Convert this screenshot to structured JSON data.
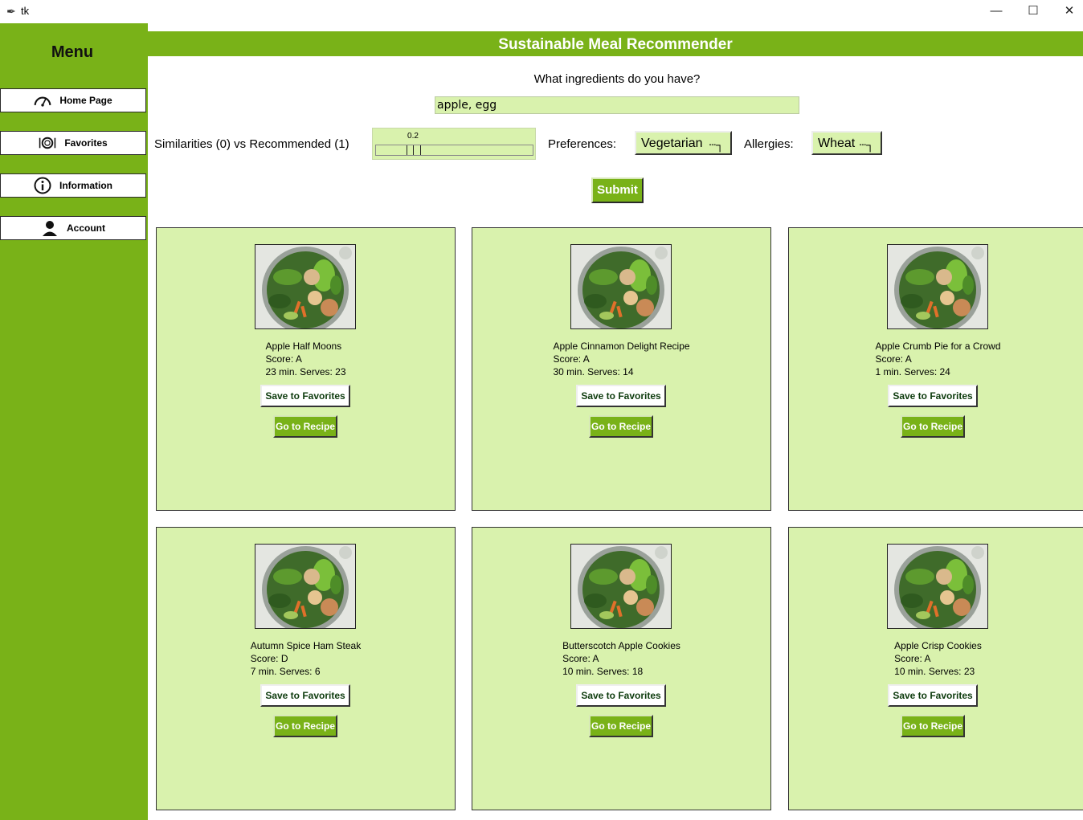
{
  "window": {
    "title": "tk",
    "icon": "feather-icon",
    "controls": [
      "minimize-icon",
      "maximize-icon",
      "close-icon"
    ]
  },
  "sidebar": {
    "title": "Menu",
    "items": [
      {
        "label": "Home Page",
        "icon": "speedometer-icon"
      },
      {
        "label": "Favorites",
        "icon": "plate-cutlery-icon"
      },
      {
        "label": "Information",
        "icon": "info-icon"
      },
      {
        "label": "Account",
        "icon": "person-icon"
      }
    ]
  },
  "header": {
    "title": "Sustainable Meal Recommender"
  },
  "search": {
    "question": "What ingredients do you have?",
    "value": "apple, egg"
  },
  "controls": {
    "slider_label": "Similarities (0) vs Recommended (1)",
    "slider_value": "0.2",
    "preferences_label": "Preferences:",
    "preferences_value": "Vegetarian",
    "allergies_label": "Allergies:",
    "allergies_value": "Wheat",
    "submit_label": "Submit"
  },
  "colors": {
    "accent": "#79b218",
    "card_bg": "#d9f2ad"
  },
  "recipes": [
    {
      "name": "Apple Half Moons",
      "score": "Score: A",
      "time_serves": "23 min. Serves: 23",
      "save_label": "Save to Favorites",
      "go_label": "Go to Recipe"
    },
    {
      "name": "Apple Cinnamon Delight Recipe",
      "score": "Score: A",
      "time_serves": "30 min. Serves: 14",
      "save_label": "Save to Favorites",
      "go_label": "Go to Recipe"
    },
    {
      "name": "Apple Crumb Pie for a Crowd",
      "score": "Score: A",
      "time_serves": "1 min. Serves: 24",
      "save_label": "Save to Favorites",
      "go_label": "Go to Recipe"
    },
    {
      "name": "Autumn Spice Ham Steak",
      "score": "Score: D",
      "time_serves": "7 min. Serves: 6",
      "save_label": "Save to Favorites",
      "go_label": "Go to Recipe"
    },
    {
      "name": "Butterscotch Apple Cookies",
      "score": "Score: A",
      "time_serves": "10 min. Serves: 18",
      "save_label": "Save to Favorites",
      "go_label": "Go to Recipe"
    },
    {
      "name": "Apple Crisp Cookies",
      "score": "Score: A",
      "time_serves": "10 min. Serves: 23",
      "save_label": "Save to Favorites",
      "go_label": "Go to Recipe"
    }
  ]
}
